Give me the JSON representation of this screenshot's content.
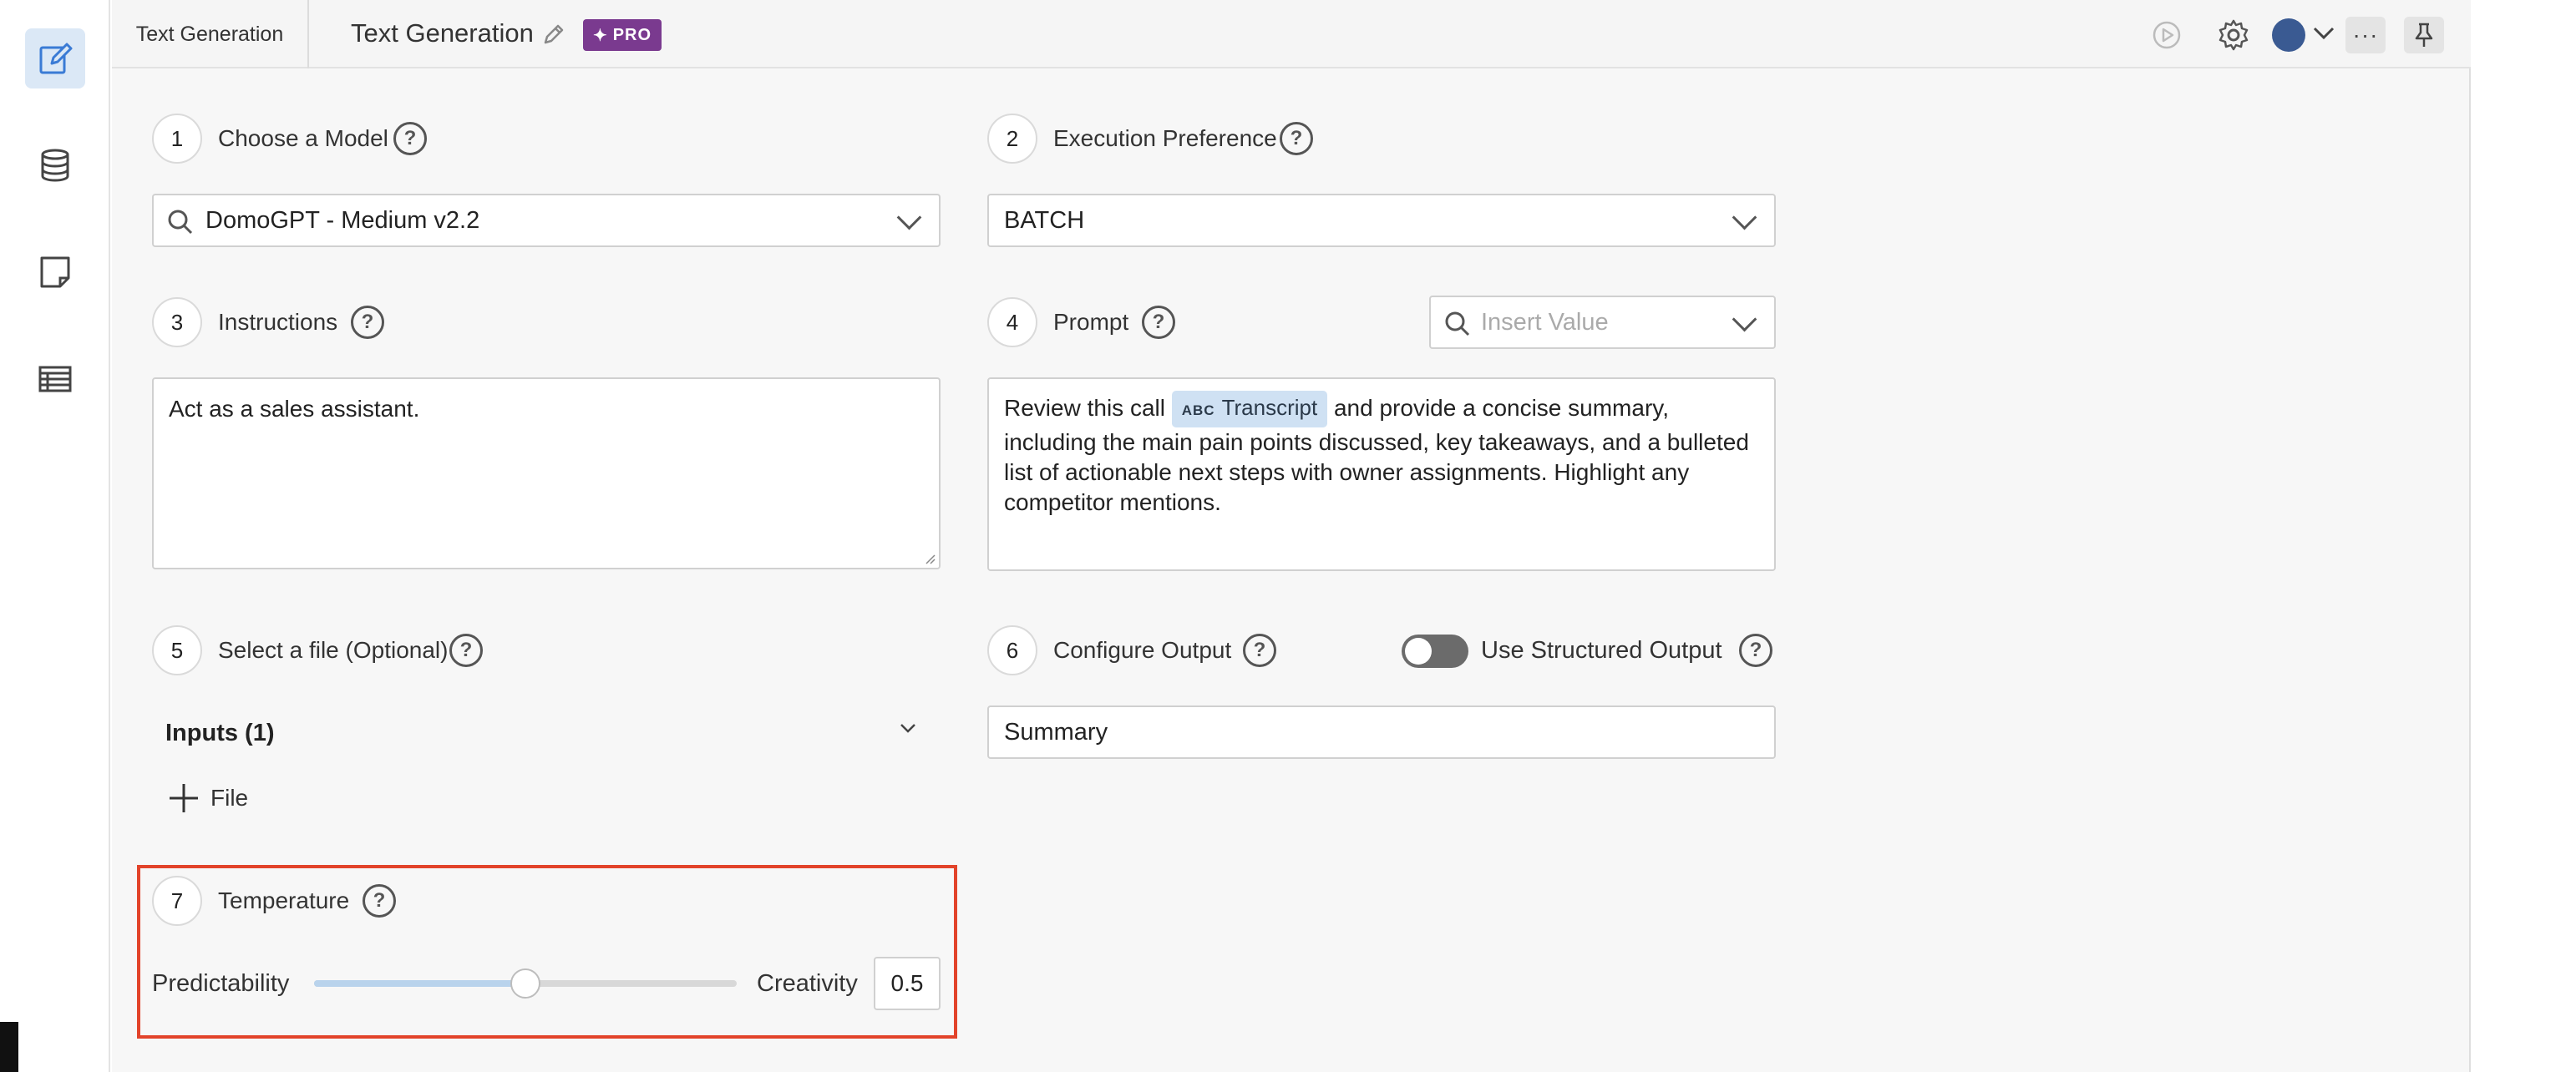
{
  "header": {
    "tab_label": "Text Generation",
    "title": "Text Generation",
    "pro_badge": "PRO"
  },
  "sidebar": {
    "items": [
      {
        "icon": "edit-icon",
        "active": true
      },
      {
        "icon": "database-icon",
        "active": false
      },
      {
        "icon": "note-icon",
        "active": false
      },
      {
        "icon": "table-icon",
        "active": false
      }
    ]
  },
  "toolbar": {
    "icons": [
      "run-icon",
      "settings-icon",
      "avatar",
      "more-icon",
      "pin-icon"
    ]
  },
  "steps": {
    "model": {
      "number": "1",
      "label": "Choose a Model",
      "value": "DomoGPT - Medium v2.2"
    },
    "execution": {
      "number": "2",
      "label": "Execution Preference",
      "value": "BATCH"
    },
    "instructions": {
      "number": "3",
      "label": "Instructions",
      "value": "Act as a sales assistant."
    },
    "prompt": {
      "number": "4",
      "label": "Prompt",
      "insert_placeholder": "Insert Value",
      "text_before": "Review this call",
      "chip_type": "ABC",
      "chip_label": "Transcript",
      "text_after_line1": "and provide a concise summary,",
      "text_rest": "including the main pain points discussed, key takeaways, and a bulleted list of actionable next steps with owner assignments. Highlight any competitor mentions."
    },
    "file": {
      "number": "5",
      "label": "Select a file (Optional)",
      "inputs_label": "Inputs (1)",
      "add_file_label": "File"
    },
    "output": {
      "number": "6",
      "label": "Configure Output",
      "structured_label": "Use Structured Output",
      "structured_on": false,
      "value": "Summary"
    },
    "temperature": {
      "number": "7",
      "label": "Temperature",
      "left_label": "Predictability",
      "right_label": "Creativity",
      "value": "0.5",
      "fraction": 0.5
    }
  },
  "help_glyph": "?",
  "colors": {
    "accent_active": "#dbe8f6",
    "pro_badge": "#7a3a8f",
    "highlight_border": "#e2432a",
    "avatar": "#3a5a92"
  }
}
